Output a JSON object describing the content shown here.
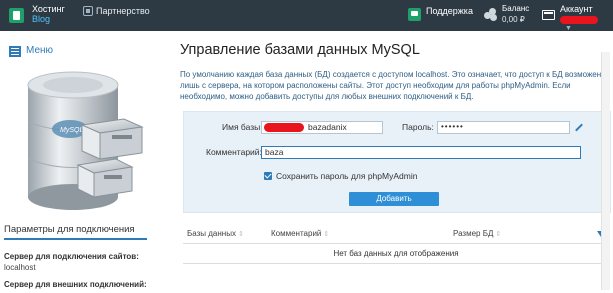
{
  "topbar": {
    "logo_line1": "Хостинг",
    "logo_line2": "Blog",
    "partner": "Партнерство",
    "support": "Поддержка",
    "balance_label": "Баланс",
    "balance_value": "0,00 ₽",
    "account": "Аккаунт"
  },
  "sidebar": {
    "menu": "Меню",
    "connection_title": "Параметры для подключения",
    "sites_server_label": "Сервер для подключения сайтов:",
    "sites_server_value": "localhost",
    "external_server_label": "Сервер для внешних подключений:"
  },
  "main": {
    "title": "Управление базами данных MySQL",
    "description": "По умолчанию каждая база данных (БД) создается с доступом localhost. Это означает, что доступ к БД возможен лишь с сервера, на котором расположены сайты. Этот доступ необходим для работы phpMyAdmin. Если необходимо, можно добавить доступы для любых внешних подключений к БД."
  },
  "form": {
    "db_name_label": "Имя базы:",
    "db_name_value": "bazadanix",
    "password_label": "Пароль:",
    "password_value": "••••••",
    "comment_label": "Комментарий:",
    "comment_value": "baza",
    "save_password_label": "Сохранить пароль для phpMyAdmin",
    "save_password_checked": true,
    "add_button": "Добавить"
  },
  "table": {
    "columns": [
      "Базы данных",
      "Комментарий",
      "Размер БД"
    ],
    "empty_text": "Нет баз данных для отображения"
  },
  "colors": {
    "topbar_bg": "#2e3a43",
    "accent": "#2e7bb8",
    "button": "#2e8fd6",
    "form_bg": "#e9f1f8",
    "redaction": "#e8141e"
  }
}
